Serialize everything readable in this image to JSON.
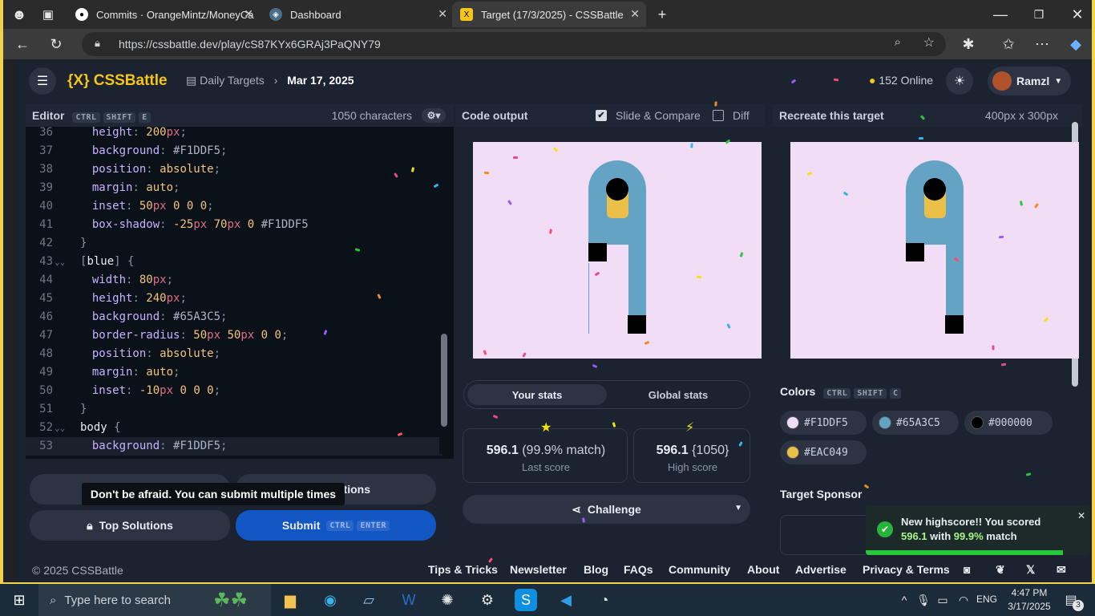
{
  "browser": {
    "tabs": [
      {
        "label": "Commits · OrangeMintz/MoneyCa",
        "active": false
      },
      {
        "label": "Dashboard",
        "active": false
      },
      {
        "label": "Target (17/3/2025) - CSSBattle",
        "active": true
      }
    ],
    "new_tab": "+",
    "url": "https://cssbattle.dev/play/cS87KYx6GRAj3PaQNY79"
  },
  "app": {
    "logo": "{X} CSSBattle",
    "breadcrumb": {
      "section": "Daily Targets",
      "date": "Mar 17, 2025"
    },
    "online": "152 Online",
    "user": "Ramzl"
  },
  "editor": {
    "title": "Editor",
    "shortcut": [
      "CTRL",
      "SHIFT",
      "E"
    ],
    "chars": "1050 characters",
    "lines": [
      {
        "n": "36",
        "tokens": [
          [
            "prop",
            "  height"
          ],
          [
            "punc",
            ": "
          ],
          [
            "num",
            "200"
          ],
          [
            "unit",
            "px"
          ],
          [
            "punc",
            ";"
          ]
        ]
      },
      {
        "n": "37",
        "tokens": [
          [
            "prop",
            "  background"
          ],
          [
            "punc",
            ": "
          ],
          [
            "hash",
            "#F1DDF5"
          ],
          [
            "punc",
            ";"
          ]
        ]
      },
      {
        "n": "38",
        "tokens": [
          [
            "prop",
            "  position"
          ],
          [
            "punc",
            ": "
          ],
          [
            "val",
            "absolute"
          ],
          [
            "punc",
            ";"
          ]
        ]
      },
      {
        "n": "39",
        "tokens": [
          [
            "prop",
            "  margin"
          ],
          [
            "punc",
            ": "
          ],
          [
            "val",
            "auto"
          ],
          [
            "punc",
            ";"
          ]
        ]
      },
      {
        "n": "40",
        "tokens": [
          [
            "prop",
            "  inset"
          ],
          [
            "punc",
            ": "
          ],
          [
            "num",
            "50"
          ],
          [
            "unit",
            "px"
          ],
          [
            "num",
            " 0 0 0"
          ],
          [
            "punc",
            ";"
          ]
        ]
      },
      {
        "n": "41",
        "tokens": [
          [
            "prop",
            "  box-shadow"
          ],
          [
            "punc",
            ": "
          ],
          [
            "num",
            "-25"
          ],
          [
            "unit",
            "px"
          ],
          [
            "num",
            " 70"
          ],
          [
            "unit",
            "px"
          ],
          [
            "num",
            " 0 "
          ],
          [
            "hash",
            "#F1DDF5"
          ]
        ]
      },
      {
        "n": "42",
        "tokens": [
          [
            "punc",
            "}"
          ]
        ]
      },
      {
        "n": "43",
        "tokens": [
          [
            "punc",
            "["
          ],
          [
            "sel",
            "blue"
          ],
          [
            "punc",
            "] {"
          ]
        ]
      },
      {
        "n": "44",
        "tokens": [
          [
            "prop",
            "  width"
          ],
          [
            "punc",
            ": "
          ],
          [
            "num",
            "80"
          ],
          [
            "unit",
            "px"
          ],
          [
            "punc",
            ";"
          ]
        ]
      },
      {
        "n": "45",
        "tokens": [
          [
            "prop",
            "  height"
          ],
          [
            "punc",
            ": "
          ],
          [
            "num",
            "240"
          ],
          [
            "unit",
            "px"
          ],
          [
            "punc",
            ";"
          ]
        ]
      },
      {
        "n": "46",
        "tokens": [
          [
            "prop",
            "  background"
          ],
          [
            "punc",
            ": "
          ],
          [
            "hash",
            "#65A3C5"
          ],
          [
            "punc",
            ";"
          ]
        ]
      },
      {
        "n": "47",
        "tokens": [
          [
            "prop",
            "  border-radius"
          ],
          [
            "punc",
            ": "
          ],
          [
            "num",
            "50"
          ],
          [
            "unit",
            "px"
          ],
          [
            "num",
            " 50"
          ],
          [
            "unit",
            "px"
          ],
          [
            "num",
            " 0 0"
          ],
          [
            "punc",
            ";"
          ]
        ]
      },
      {
        "n": "48",
        "tokens": [
          [
            "prop",
            "  position"
          ],
          [
            "punc",
            ": "
          ],
          [
            "val",
            "absolute"
          ],
          [
            "punc",
            ";"
          ]
        ]
      },
      {
        "n": "49",
        "tokens": [
          [
            "prop",
            "  margin"
          ],
          [
            "punc",
            ": "
          ],
          [
            "val",
            "auto"
          ],
          [
            "punc",
            ";"
          ]
        ]
      },
      {
        "n": "50",
        "tokens": [
          [
            "prop",
            "  inset"
          ],
          [
            "punc",
            ": "
          ],
          [
            "num",
            "-10"
          ],
          [
            "unit",
            "px"
          ],
          [
            "num",
            " 0 0 0"
          ],
          [
            "punc",
            ";"
          ]
        ]
      },
      {
        "n": "51",
        "tokens": [
          [
            "punc",
            "}"
          ]
        ]
      },
      {
        "n": "52",
        "tokens": [
          [
            "sel",
            "body"
          ],
          [
            "punc",
            " {"
          ]
        ]
      },
      {
        "n": "53",
        "tokens": [
          [
            "prop",
            "  background"
          ],
          [
            "punc",
            ": "
          ],
          [
            "hash",
            "#F1DDF5"
          ],
          [
            "punc",
            ";"
          ]
        ]
      }
    ],
    "fold_lines": [
      "43",
      "52"
    ],
    "tooltip": "Don't be afraid. You can submit multiple times",
    "solutions_btn": "Solutions",
    "top_solutions": "Top Solutions",
    "submit": "Submit",
    "submit_shortcut": [
      "CTRL",
      "ENTER"
    ]
  },
  "output": {
    "title": "Code output",
    "slide_compare": "Slide & Compare",
    "slide_checked": true,
    "diff": "Diff",
    "diff_checked": false,
    "tabs": [
      "Your stats",
      "Global stats"
    ],
    "last_score": "596.1",
    "last_match": "(99.9% match)",
    "last_label": "Last score",
    "high_score": "596.1",
    "high_chars": "{1050}",
    "high_label": "High score",
    "challenge": "Challenge"
  },
  "target": {
    "title": "Recreate this target",
    "size": "400px x 300px",
    "colors_title": "Colors",
    "colors_shortcut": [
      "CTRL",
      "SHIFT",
      "C"
    ],
    "colors": [
      "#F1DDF5",
      "#65A3C5",
      "#000000",
      "#EAC049"
    ],
    "sponsor_title": "Target Sponsor"
  },
  "toast": {
    "line1": "New highscore!! You scored",
    "score": "596.1",
    "with": "with",
    "match": "99.9%",
    "match_word": "match",
    "progress": 0.88
  },
  "footer": {
    "copyright": "© 2025 CSSBattle",
    "links": [
      "Tips & Tricks",
      "Newsletter",
      "Blog",
      "FAQs",
      "Community",
      "About",
      "Advertise",
      "Privacy & Terms"
    ]
  },
  "taskbar": {
    "search": "Type here to search",
    "lang": "ENG",
    "time": "4:47 PM",
    "date": "3/17/2025",
    "notifications": "3"
  }
}
